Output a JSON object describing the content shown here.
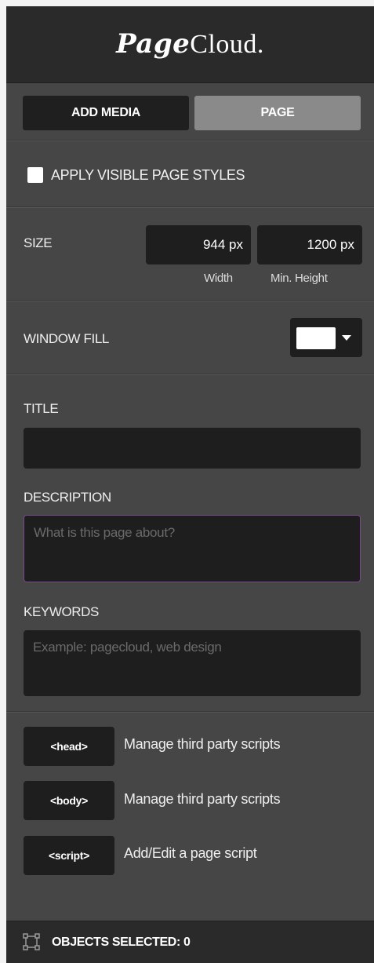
{
  "app": {
    "logo_brand": "Page",
    "logo_tail": "Cloud."
  },
  "tabs": {
    "add_media": "ADD MEDIA",
    "page": "PAGE",
    "active": "page"
  },
  "page_styles": {
    "label": "APPLY VISIBLE PAGE STYLES",
    "checked": false
  },
  "size": {
    "label": "SIZE",
    "width_value": "944 px",
    "width_label": "Width",
    "height_value": "1200 px",
    "height_label": "Min. Height"
  },
  "window_fill": {
    "label": "WINDOW FILL",
    "color": "#ffffff"
  },
  "title": {
    "label": "TITLE",
    "value": ""
  },
  "description": {
    "label": "DESCRIPTION",
    "placeholder": "What is this page about?",
    "value": ""
  },
  "keywords": {
    "label": "KEYWORDS",
    "placeholder": "Example: pagecloud, web design",
    "value": ""
  },
  "scripts": [
    {
      "tag": "<head>",
      "desc": "Manage third party scripts"
    },
    {
      "tag": "<body>",
      "desc": "Manage third party scripts"
    },
    {
      "tag": "<script>",
      "desc": "Add/Edit a page script"
    }
  ],
  "footer": {
    "label": "OBJECTS SELECTED:",
    "count": "0"
  },
  "colors": {
    "accent_border": "#7a4a8a",
    "panel": "#464646",
    "dark": "#1e1e1e"
  }
}
